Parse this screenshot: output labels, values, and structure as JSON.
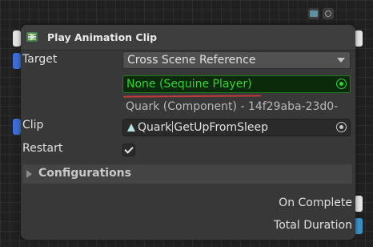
{
  "node": {
    "title": "Play Animation Clip",
    "fields": {
      "target_label": "Target",
      "target_mode": "Cross Scene Reference",
      "reference_value": "None (Sequine Player)",
      "reference_info": "Quark (Component) - 14f29aba-23d0-",
      "clip_label": "Clip",
      "clip_value_prefix": "Quark",
      "clip_value_suffix": "GetUpFromSleep",
      "restart_label": "Restart",
      "restart_checked": true
    },
    "configurations_label": "Configurations",
    "outputs": [
      {
        "label": "On Complete",
        "port_color": "#e4e4e4"
      },
      {
        "label": "Total Duration",
        "port_color": "#3b90c4"
      }
    ]
  },
  "icons": {
    "header": "play-animation-icon",
    "top_slot": "circle-slot-icon",
    "top_node": "node-icon",
    "clip": "animation-clip-icon"
  },
  "colors": {
    "reference_text": "#2fd62f",
    "reference_border": "#1e7a1e",
    "annotation_underline": "#c23a3a",
    "input_port": "#3d6ed8"
  }
}
